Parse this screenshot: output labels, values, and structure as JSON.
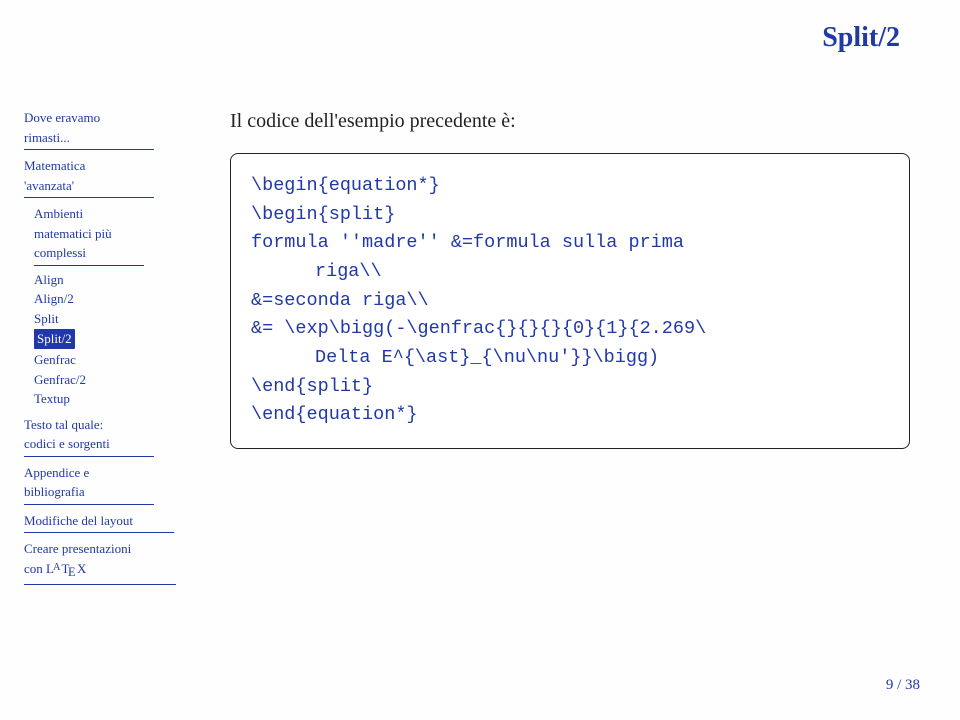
{
  "title": "Split/2",
  "sidebar": {
    "s1": {
      "line1": "Dove eravamo",
      "line2": "rimasti..."
    },
    "s2": {
      "line1": "Matematica",
      "line2": "'avanzata'",
      "items": [
        "Ambienti",
        "matematici più",
        "complessi",
        "Align",
        "Align/2",
        "Split",
        "Split/2",
        "Genfrac",
        "Genfrac/2",
        "Textup"
      ]
    },
    "s3": {
      "line1": "Testo tal quale:",
      "line2": "codici e sorgenti"
    },
    "s4": {
      "line1": "Appendice e",
      "line2": "bibliografia"
    },
    "s5": {
      "line1": "Modifiche del layout"
    },
    "s6": {
      "line1": "Creare presentazioni",
      "line2_pre": "con "
    }
  },
  "content": {
    "intro": "Il codice dell'esempio precedente è:",
    "code": {
      "l1": "\\begin{equation*}",
      "l2": "\\begin{split}",
      "l3": "formula ''madre'' &=formula sulla prima",
      "l3b": "riga\\\\",
      "l4": "&=seconda riga\\\\",
      "l5": "&= \\exp\\bigg(-\\genfrac{}{}{}{0}{1}{2.269\\",
      "l5b": "Delta E^{\\ast}_{\\nu\\nu'}}\\bigg)",
      "l6": "\\end{split}",
      "l7": "\\end{equation*}"
    }
  },
  "pagenum": "9 / 38"
}
